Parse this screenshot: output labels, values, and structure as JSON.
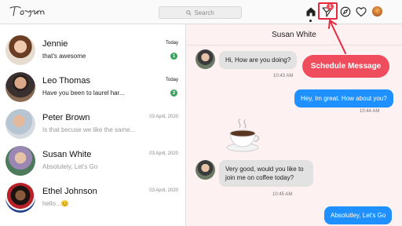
{
  "topbar": {
    "search_placeholder": "Search",
    "notification_count": "1"
  },
  "conversations": [
    {
      "name": "Jennie",
      "preview": "that's awesome",
      "time": "Today",
      "unread": "1"
    },
    {
      "name": "Leo Thomas",
      "preview": "Have you been to laurel har...",
      "time": "Today",
      "unread": "2"
    },
    {
      "name": "Peter Brown",
      "preview": "Is that becuse we like the same...",
      "time": "03 April, 2020",
      "unread": ""
    },
    {
      "name": "Susan White",
      "preview": "Absolutely, Let's Go",
      "time": "03 April, 2020",
      "unread": ""
    },
    {
      "name": "Ethel Johnson",
      "preview": "hello...😊",
      "time": "03 April, 2020",
      "unread": ""
    }
  ],
  "chat": {
    "contact_name": "Susan White",
    "messages": [
      {
        "text": "Hi, How are you doing?",
        "time": "10:43 AM"
      },
      {
        "text": "Hey, Im great. How about you?",
        "time": "10:44 AM"
      },
      {
        "text": "Very good, would you like to join me on coffee today?",
        "time": "10:45 AM"
      },
      {
        "text": "Absolutley, Let's Go",
        "time": ""
      }
    ]
  },
  "overlay": {
    "schedule_label": "Schedule Message",
    "accent_color": "#ef4d5e",
    "highlight_color": "#e8283f"
  }
}
